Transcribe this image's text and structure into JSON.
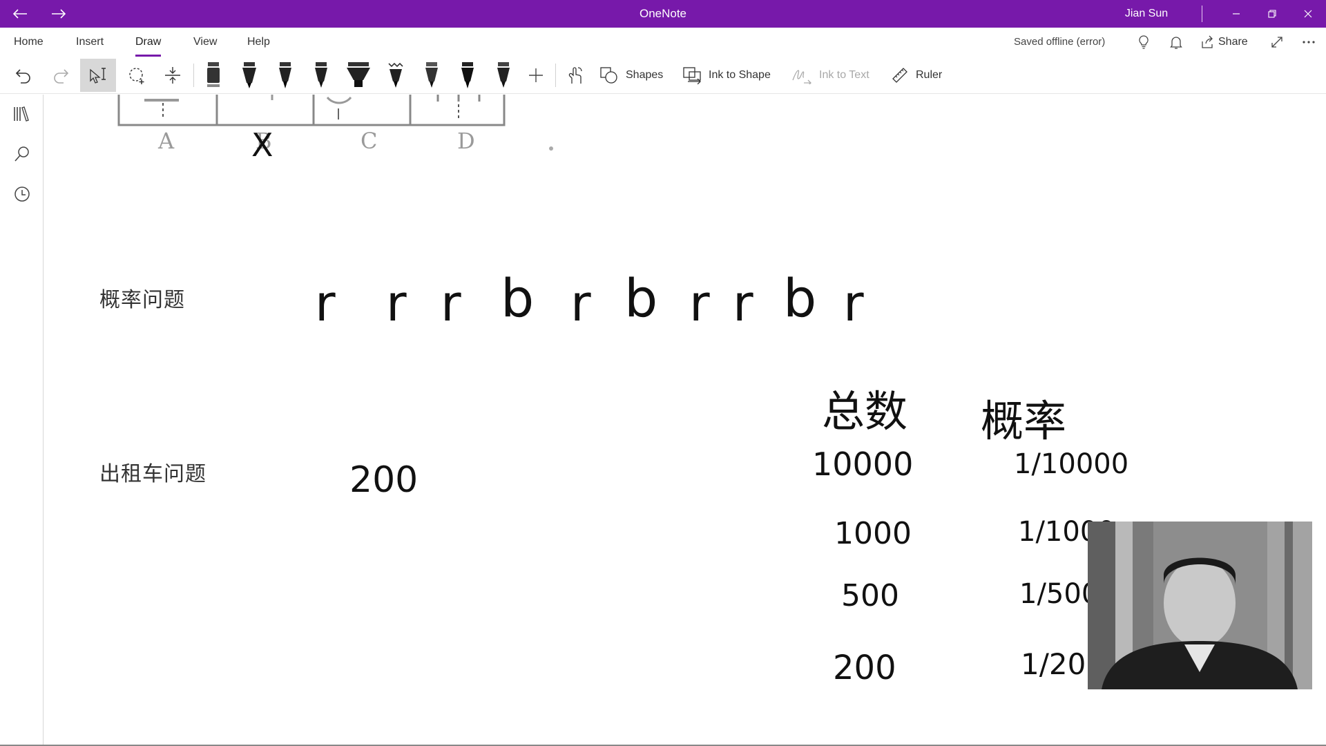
{
  "titlebar": {
    "app_title": "OneNote",
    "user_name": "Jian Sun",
    "color": "#7719aa"
  },
  "menu": {
    "tabs": [
      "Home",
      "Insert",
      "Draw",
      "View",
      "Help"
    ],
    "active_tab": "Draw",
    "status": "Saved offline (error)",
    "share_label": "Share"
  },
  "toolbar": {
    "shapes_label": "Shapes",
    "ink_to_shape_label": "Ink to Shape",
    "ink_to_text_label": "Ink to Text",
    "ruler_label": "Ruler",
    "pens": [
      {
        "name": "pen-gray",
        "color": "#555555"
      },
      {
        "name": "pen-black-1",
        "color": "#111111"
      },
      {
        "name": "pen-black-2",
        "color": "#222222"
      },
      {
        "name": "pen-black-3",
        "color": "#222222"
      },
      {
        "name": "highlighter",
        "color": "#333333"
      },
      {
        "name": "pen-pattern",
        "color": "#333333"
      },
      {
        "name": "pen-black-4",
        "color": "#222222"
      },
      {
        "name": "pen-black-5",
        "color": "#111111"
      },
      {
        "name": "pen-black-6",
        "color": "#222222"
      }
    ]
  },
  "page": {
    "figure_labels": [
      "A",
      "B",
      "C",
      "D"
    ],
    "figure_mark": "X",
    "prob_problem_label": "概率问题",
    "ball_sequence": [
      "r",
      "r",
      "r",
      "b",
      "r",
      "b",
      "r",
      "r",
      "b",
      "r"
    ],
    "taxi_problem_label": "出租车问题",
    "taxi_value": "200",
    "table_headers": [
      "总数",
      "概率"
    ],
    "table_rows": [
      {
        "total": "10000",
        "prob": "1/10000"
      },
      {
        "total": "1000",
        "prob": "1/1000"
      },
      {
        "total": "500",
        "prob": "1/500"
      },
      {
        "total": "200",
        "prob": "1/200"
      }
    ]
  }
}
